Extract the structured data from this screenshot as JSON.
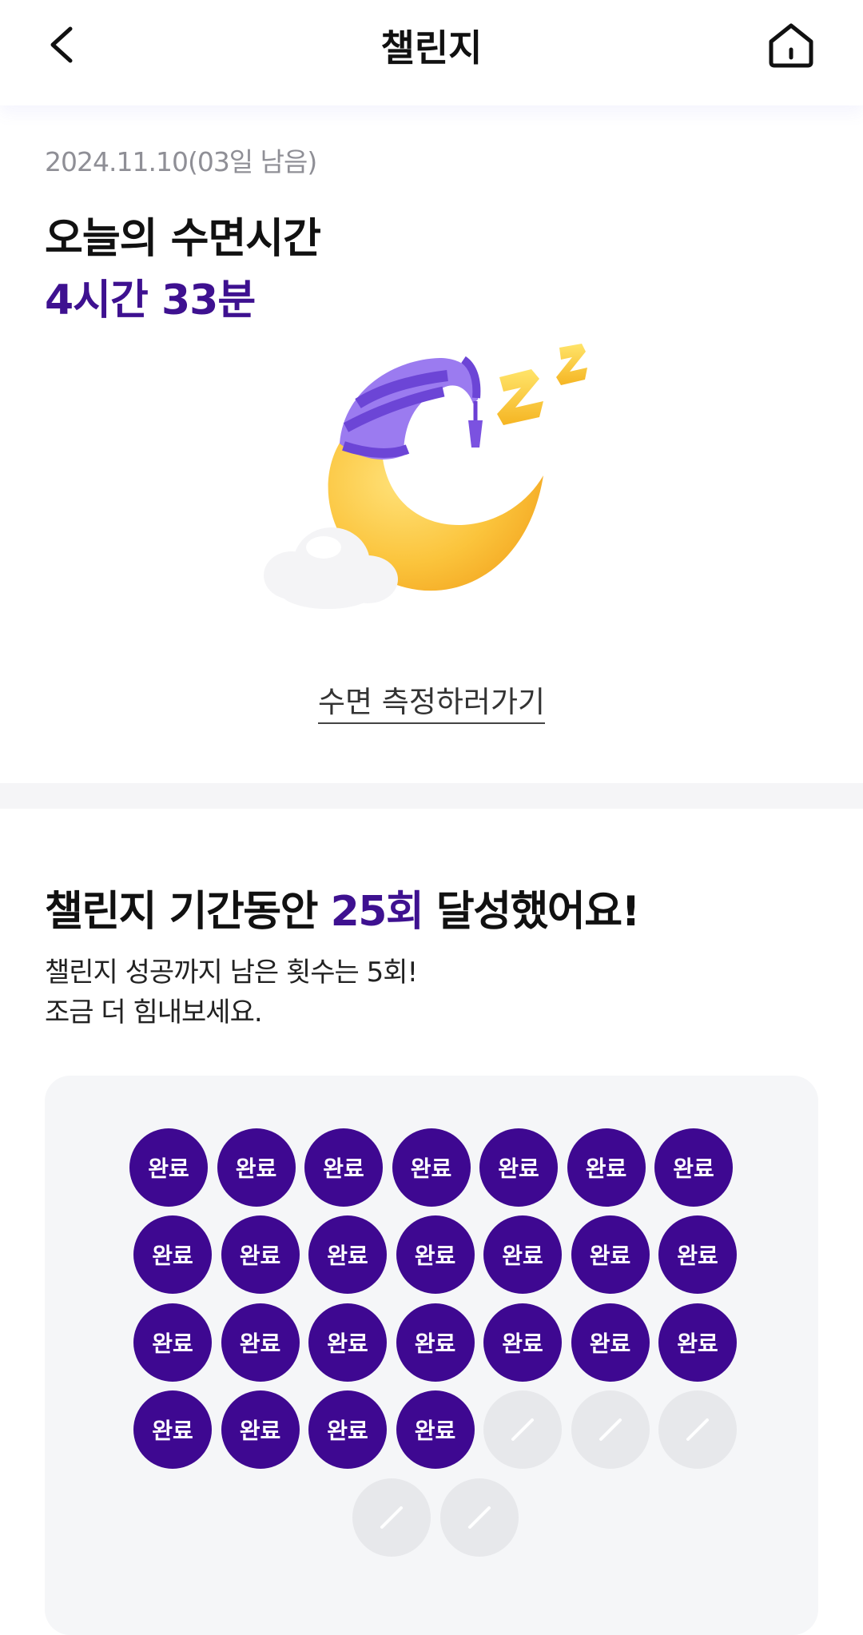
{
  "header": {
    "title": "챌린지"
  },
  "today": {
    "date_text": "2024.11.10(03일 남음)",
    "label": "오늘의 수면시간",
    "value": "4시간 33분"
  },
  "measure_link": "수면 측정하러가기",
  "achievement": {
    "title_prefix": "챌린지 기간동안 ",
    "count": "25회",
    "title_suffix": " 달성했어요!",
    "desc_line1": "챌린지 성공까지 남은 횟수는 5회!",
    "desc_line2": "조금 더 힘내보세요."
  },
  "stamps": {
    "done_label": "완료",
    "total": 30,
    "completed": 25
  },
  "icons": {
    "back": "chevron-left-icon",
    "home": "home-icon",
    "illustration": "sleeping-moon-illustration"
  },
  "colors": {
    "accent": "#3e1190",
    "stamp_done": "#3e0891",
    "stamp_pending": "#e7e8eb"
  }
}
